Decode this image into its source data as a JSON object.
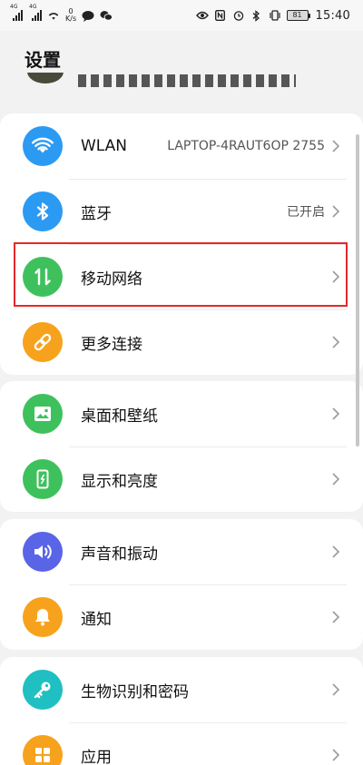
{
  "status_bar": {
    "signal1": "4G",
    "signal2": "4G",
    "speed_value": "0",
    "speed_unit": "K/s",
    "battery": "81",
    "time": "15:40"
  },
  "header": {
    "title": "设置"
  },
  "groups": [
    {
      "items": [
        {
          "label": "WLAN",
          "value": "LAPTOP-4RAUT6OP 2755",
          "icon": "wifi-icon",
          "color": "#2b9af3"
        },
        {
          "label": "蓝牙",
          "value": "已开启",
          "icon": "bluetooth-icon",
          "color": "#2b9af3"
        },
        {
          "label": "移动网络",
          "icon": "mobile-data-icon",
          "color": "#3ec15d"
        },
        {
          "label": "更多连接",
          "icon": "link-icon",
          "color": "#f7a21c"
        }
      ]
    },
    {
      "items": [
        {
          "label": "桌面和壁纸",
          "icon": "wallpaper-icon",
          "color": "#3ec15d"
        },
        {
          "label": "显示和亮度",
          "icon": "display-icon",
          "color": "#3ec15d"
        }
      ]
    },
    {
      "items": [
        {
          "label": "声音和振动",
          "icon": "sound-icon",
          "color": "#5a64e6"
        },
        {
          "label": "通知",
          "icon": "bell-icon",
          "color": "#f7a21c"
        }
      ]
    },
    {
      "items": [
        {
          "label": "生物识别和密码",
          "icon": "key-icon",
          "color": "#20bfc2"
        },
        {
          "label": "应用",
          "icon": "apps-icon",
          "color": "#f7a21c"
        }
      ]
    }
  ],
  "highlight": {
    "color": "#e4292b"
  }
}
